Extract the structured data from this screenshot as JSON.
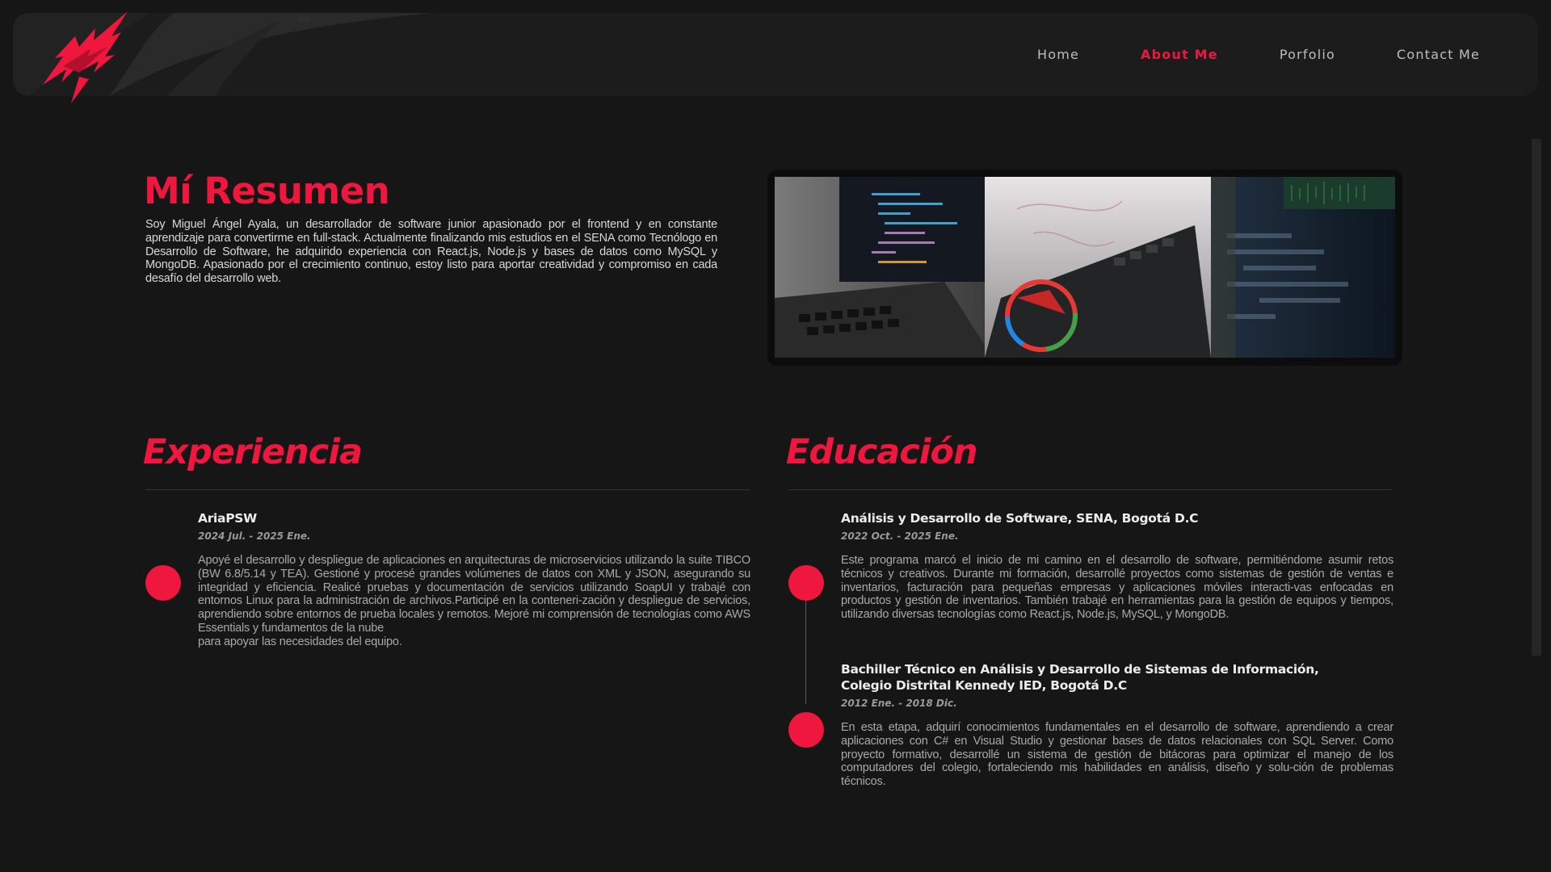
{
  "nav": {
    "links": [
      "Home",
      "About Me",
      "Porfolio",
      "Contact Me"
    ],
    "active_index": 1
  },
  "summary": {
    "title": "Mí Resumen",
    "text": "Soy Miguel Ángel Ayala, un desarrollador de software junior apasionado por el frontend y en constante aprendizaje para convertirme en full-stack. Actualmente finalizando mis estudios en el SENA como Tecnólogo en Desarrollo de Software, he adquirido experiencia con React.js, Node.js y bases de datos como MySQL y MongoDB. Apasionado por el crecimiento continuo, estoy listo para aportar creatividad y compromiso en cada desafío del desarrollo web."
  },
  "experience": {
    "title": "Experiencia",
    "items": [
      {
        "company": "AriaPSW",
        "date": "2024 Jul. - 2025 Ene.",
        "description": "Apoyé el desarrollo y despliegue de aplicaciones en arquitecturas de microservicios utilizando la suite TIBCO (BW 6.8/5.14 y TEA). Gestioné y procesé grandes volúmenes de datos con XML y JSON, asegurando su integridad y eficiencia. Realicé pruebas y documentación de servicios utilizando SoapUI y trabajé con entornos Linux para la administración de archivos.Participé en la conteneri-zación y despliegue de servicios, aprendiendo sobre entornos de prueba locales y remotos. Mejoré mi comprensión de tecnologías como AWS Essentials y fundamentos de la nube\n para apoyar las necesidades del equipo."
      }
    ]
  },
  "education": {
    "title": "Educación",
    "items": [
      {
        "title": "Análisis y Desarrollo de Software, SENA, Bogotá D.C",
        "date": "2022 Oct. - 2025 Ene.",
        "description": "Este programa marcó el inicio de mi camino en el desarrollo de software, permitiéndome asumir retos técnicos y creativos. Durante mi formación, desarrollé proyectos como sistemas de gestión de ventas e inventarios, facturación para pequeñas empresas y aplicaciones móviles interacti-vas enfocadas en productos y gestión de inventarios. También trabajé en herramientas para la gestión de equipos y tiempos, utilizando diversas tecnologías como React.js, Node.js, MySQL, y MongoDB."
      },
      {
        "title": "Bachiller Técnico en Análisis y Desarrollo de Sistemas de Información, Colegio Distrital Kennedy IED, Bogotá D.C",
        "date": "2012 Ene. - 2018 Dic.",
        "description": "En esta etapa, adquirí conocimientos fundamentales en el desarrollo de software, aprendiendo a crear aplicaciones con C# en Visual Studio y gestionar bases de datos relacionales con SQL Server. Como proyecto formativo, desarrollé un sistema de gestión de bitácoras para optimizar el manejo de los computadores del colegio, fortaleciendo mis habilidades en análisis, diseño y solu-ción de problemas técnicos."
      }
    ]
  },
  "colors": {
    "accent": "#f0173f",
    "background": "#161616",
    "navbar": "#1c1c1c"
  }
}
